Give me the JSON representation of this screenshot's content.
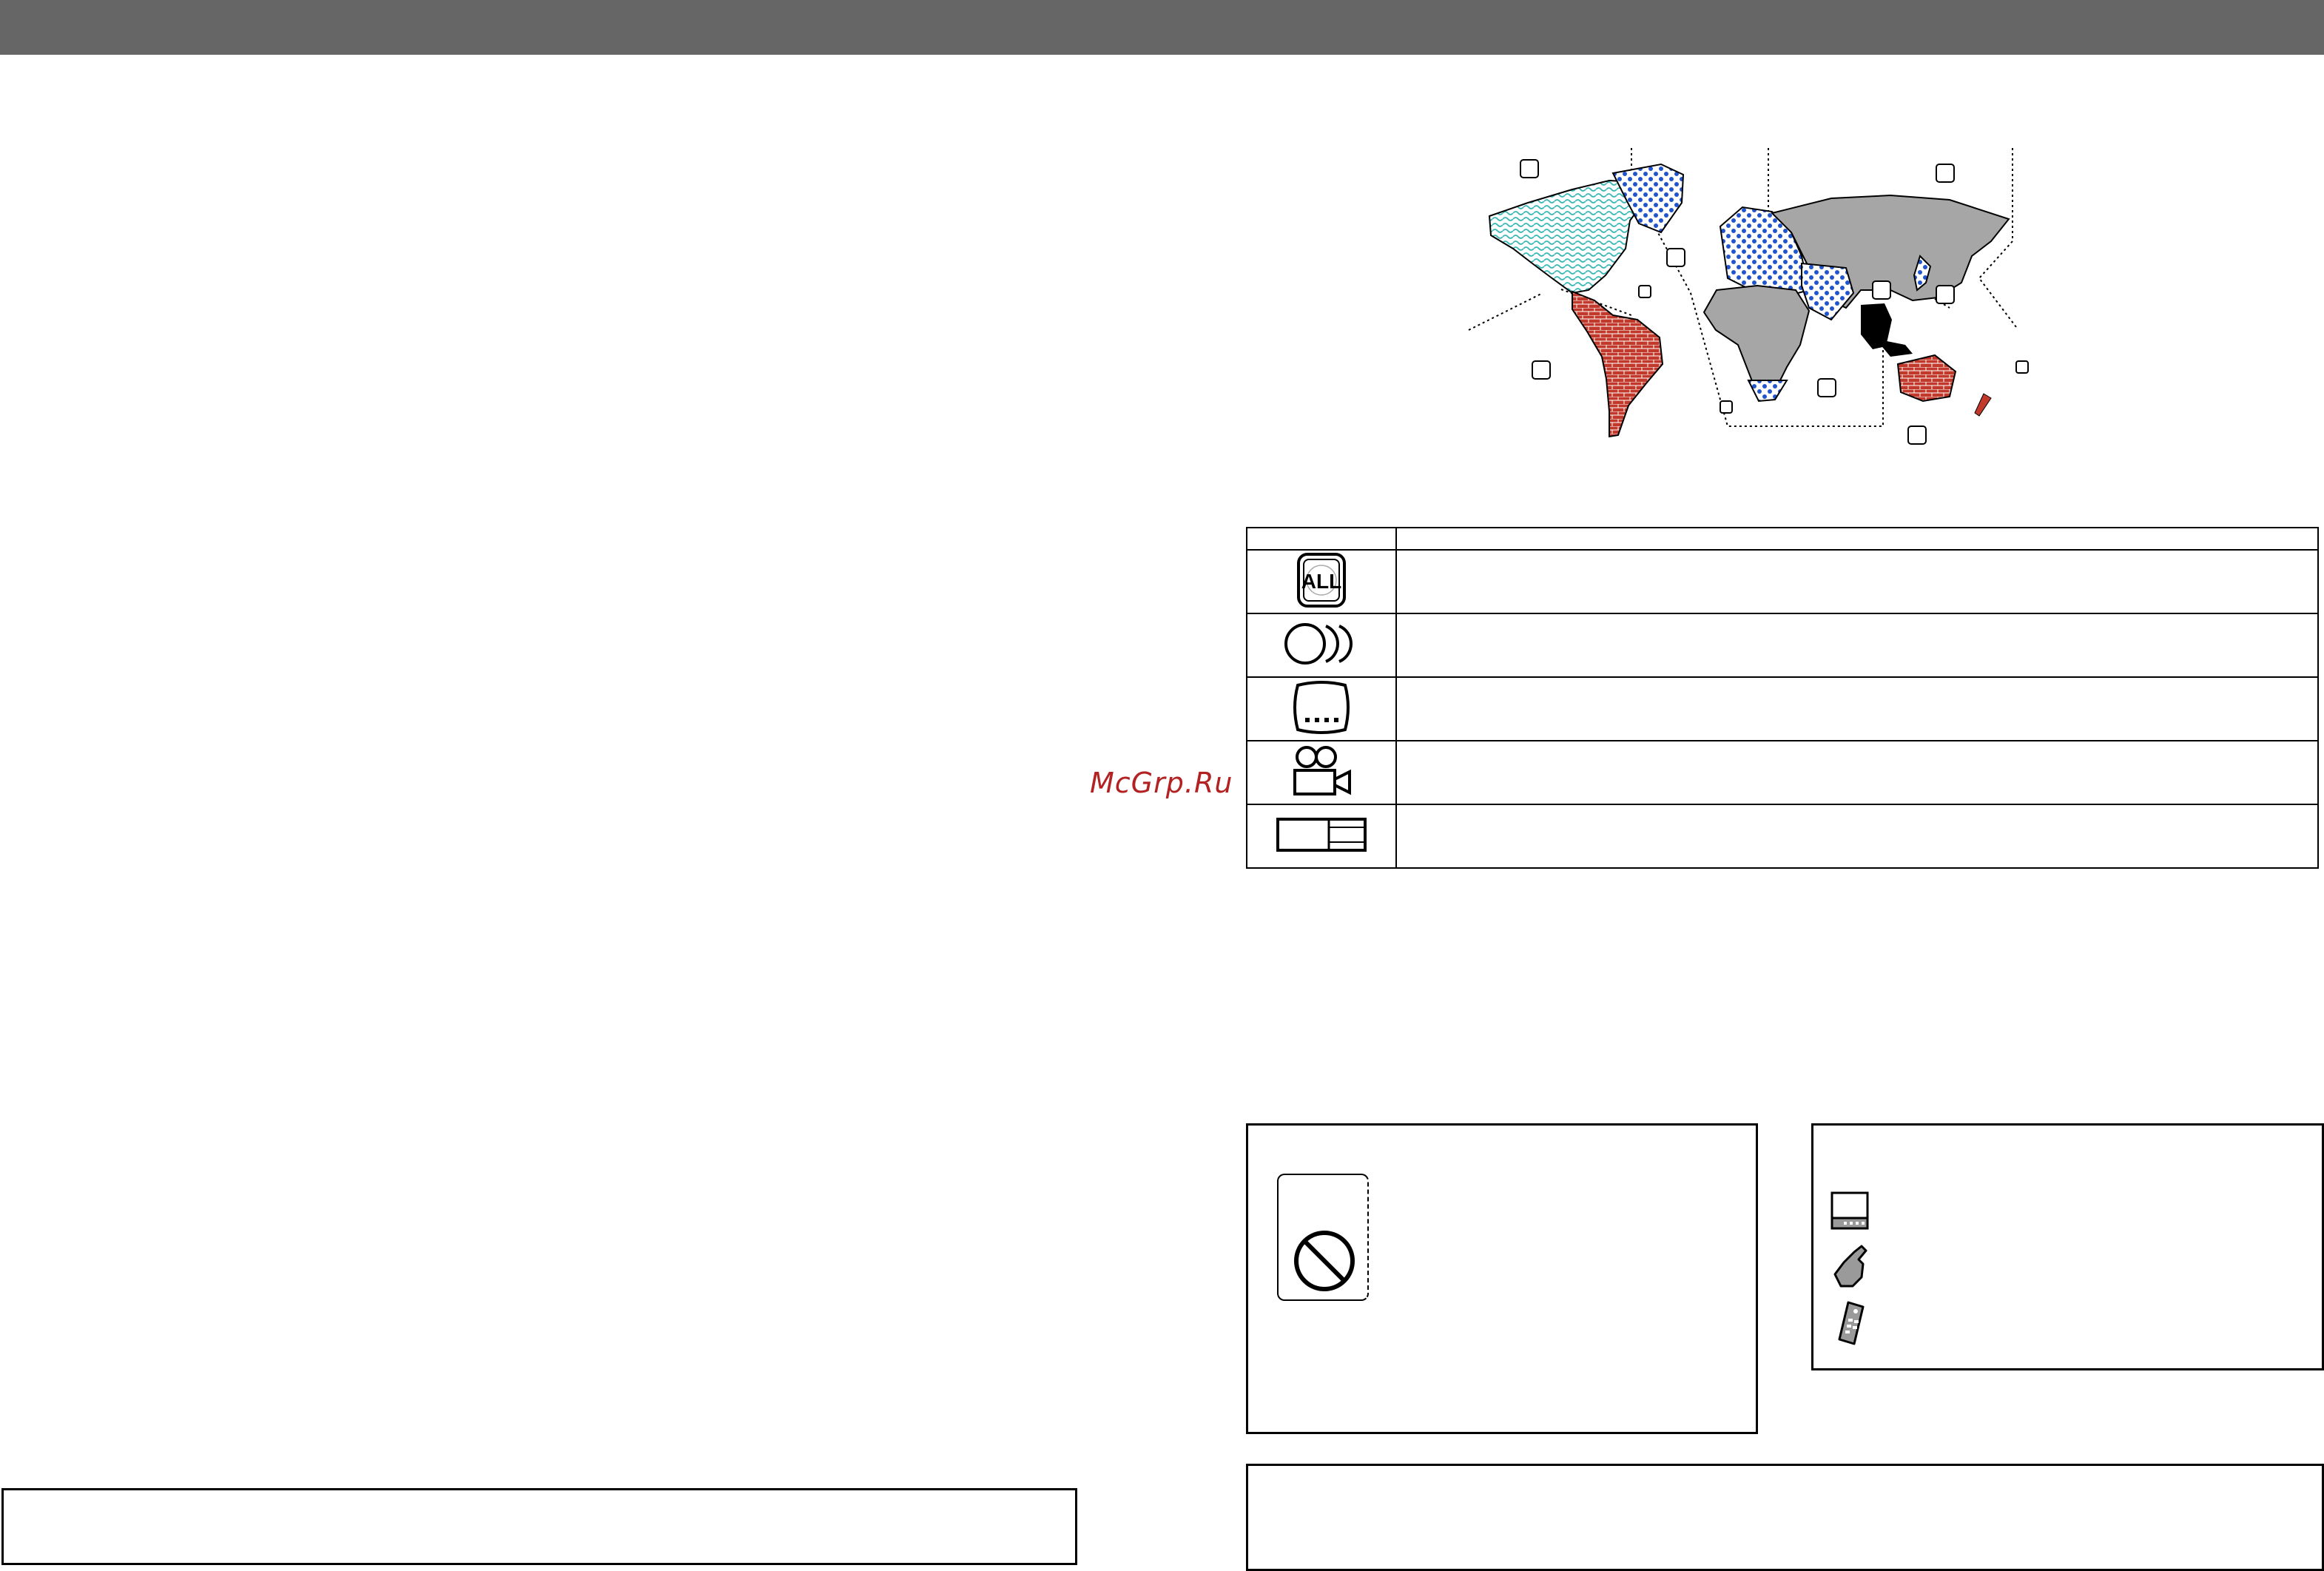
{
  "header": {
    "bar_color": "#666666"
  },
  "watermark": {
    "text": "McGrp.Ru",
    "color": "#b22222"
  },
  "region_map": {
    "colors": {
      "region1_stripes": "#39b7b7",
      "region2_dots": "#2255cc",
      "region4_bricks": "#c0392b",
      "region5_gray": "#a6a6a6",
      "region3_black": "#000000"
    },
    "icons": [
      "region-number-icon"
    ]
  },
  "symbol_table": {
    "rows": [
      {
        "icon": "all-regions-icon"
      },
      {
        "icon": "audio-languages-icon"
      },
      {
        "icon": "subtitle-languages-icon"
      },
      {
        "icon": "camera-angles-icon"
      },
      {
        "icon": "aspect-ratio-icon"
      }
    ]
  },
  "caution_box": {
    "icon": "prohibited-icon"
  },
  "operation_box": {
    "icons": [
      "monitor-icon",
      "touch-hand-icon",
      "remote-control-icon"
    ]
  }
}
